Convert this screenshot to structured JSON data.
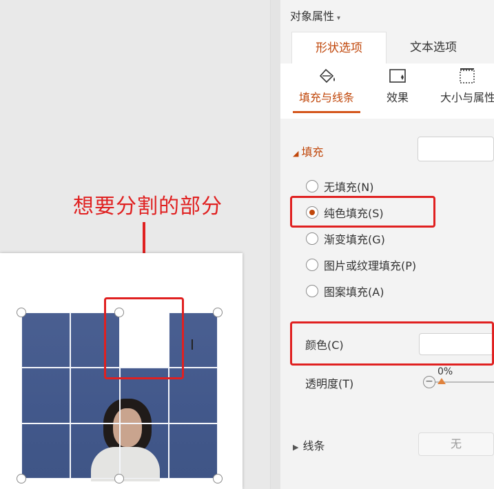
{
  "annotation": {
    "label": "想要分割的部分"
  },
  "panel": {
    "title": "对象属性",
    "tabs": [
      {
        "label": "形状选项"
      },
      {
        "label": "文本选项"
      }
    ],
    "subtabs": [
      {
        "label": "填充与线条",
        "icon": "fill-bucket-icon"
      },
      {
        "label": "效果",
        "icon": "effects-icon"
      },
      {
        "label": "大小与属性",
        "icon": "size-properties-icon"
      }
    ],
    "fill": {
      "header": "填充",
      "options": [
        {
          "label": "无填充(N)",
          "checked": false
        },
        {
          "label": "纯色填充(S)",
          "checked": true
        },
        {
          "label": "渐变填充(G)",
          "checked": false
        },
        {
          "label": "图片或纹理填充(P)",
          "checked": false
        },
        {
          "label": "图案填充(A)",
          "checked": false
        }
      ],
      "color_label": "颜色(C)",
      "transparency_label": "透明度(T)",
      "transparency_value": "0%"
    },
    "line": {
      "header": "线条",
      "value": "无"
    }
  },
  "colors": {
    "accent": "#c0470b",
    "annotation": "#e02020"
  }
}
